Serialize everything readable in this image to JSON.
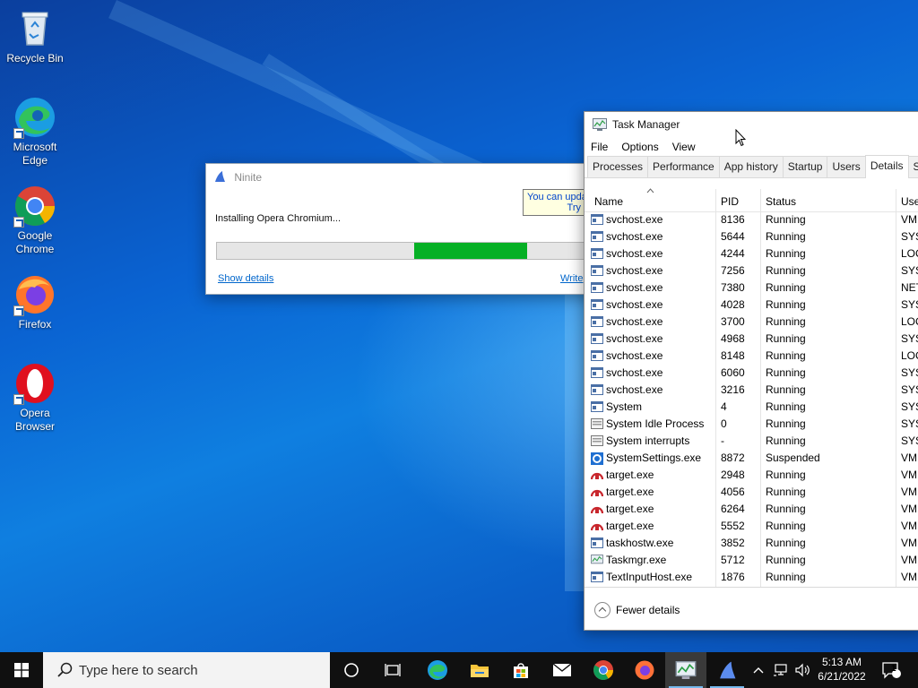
{
  "desktop_icons": [
    {
      "label": "Recycle Bin",
      "icon": "recycle-bin-icon"
    },
    {
      "label": "Microsoft Edge",
      "icon": "edge-icon"
    },
    {
      "label": "Google Chrome",
      "icon": "chrome-icon"
    },
    {
      "label": "Firefox",
      "icon": "firefox-icon"
    },
    {
      "label": "Opera Browser",
      "icon": "opera-icon"
    }
  ],
  "ninite": {
    "title": "Ninite",
    "status": "Installing Opera Chromium...",
    "progress": 0.3,
    "show_details": "Show details",
    "write_link": "Write",
    "tooltip_line1": "You can upda",
    "tooltip_line2": "Try"
  },
  "taskmgr": {
    "title": "Task Manager",
    "menu": [
      "File",
      "Options",
      "View"
    ],
    "tabs": [
      "Processes",
      "Performance",
      "App history",
      "Startup",
      "Users",
      "Details",
      "Se"
    ],
    "active_tab": "Details",
    "columns": {
      "name": "Name",
      "pid": "PID",
      "status": "Status",
      "user": "Use"
    },
    "rows": [
      {
        "name": "svchost.exe",
        "pid": "8136",
        "status": "Running",
        "user": "VM",
        "icon": "service-icon"
      },
      {
        "name": "svchost.exe",
        "pid": "5644",
        "status": "Running",
        "user": "SYS",
        "icon": "service-icon"
      },
      {
        "name": "svchost.exe",
        "pid": "4244",
        "status": "Running",
        "user": "LOC",
        "icon": "service-icon"
      },
      {
        "name": "svchost.exe",
        "pid": "7256",
        "status": "Running",
        "user": "SYS",
        "icon": "service-icon"
      },
      {
        "name": "svchost.exe",
        "pid": "7380",
        "status": "Running",
        "user": "NET",
        "icon": "service-icon"
      },
      {
        "name": "svchost.exe",
        "pid": "4028",
        "status": "Running",
        "user": "SYS",
        "icon": "service-icon"
      },
      {
        "name": "svchost.exe",
        "pid": "3700",
        "status": "Running",
        "user": "LOC",
        "icon": "service-icon"
      },
      {
        "name": "svchost.exe",
        "pid": "4968",
        "status": "Running",
        "user": "SYS",
        "icon": "service-icon"
      },
      {
        "name": "svchost.exe",
        "pid": "8148",
        "status": "Running",
        "user": "LOC",
        "icon": "service-icon"
      },
      {
        "name": "svchost.exe",
        "pid": "6060",
        "status": "Running",
        "user": "SYS",
        "icon": "service-icon"
      },
      {
        "name": "svchost.exe",
        "pid": "3216",
        "status": "Running",
        "user": "SYS",
        "icon": "service-icon"
      },
      {
        "name": "System",
        "pid": "4",
        "status": "Running",
        "user": "SYS",
        "icon": "service-icon"
      },
      {
        "name": "System Idle Process",
        "pid": "0",
        "status": "Running",
        "user": "SYS",
        "icon": "process-icon"
      },
      {
        "name": "System interrupts",
        "pid": "-",
        "status": "Running",
        "user": "SYS",
        "icon": "process-icon"
      },
      {
        "name": "SystemSettings.exe",
        "pid": "8872",
        "status": "Suspended",
        "user": "VM",
        "icon": "settings-gear-icon"
      },
      {
        "name": "target.exe",
        "pid": "2948",
        "status": "Running",
        "user": "VM",
        "icon": "target-icon"
      },
      {
        "name": "target.exe",
        "pid": "4056",
        "status": "Running",
        "user": "VM",
        "icon": "target-icon"
      },
      {
        "name": "target.exe",
        "pid": "6264",
        "status": "Running",
        "user": "VM",
        "icon": "target-icon"
      },
      {
        "name": "target.exe",
        "pid": "5552",
        "status": "Running",
        "user": "VM",
        "icon": "target-icon"
      },
      {
        "name": "taskhostw.exe",
        "pid": "3852",
        "status": "Running",
        "user": "VM",
        "icon": "service-icon"
      },
      {
        "name": "Taskmgr.exe",
        "pid": "5712",
        "status": "Running",
        "user": "VM",
        "icon": "taskmgr-icon"
      },
      {
        "name": "TextInputHost.exe",
        "pid": "1876",
        "status": "Running",
        "user": "VM",
        "icon": "service-icon"
      }
    ],
    "fewer_details": "Fewer details"
  },
  "taskbar": {
    "search_placeholder": "Type here to search",
    "time": "5:13 AM",
    "date": "6/21/2022",
    "notification_count": "1"
  },
  "colors": {
    "progress_green": "#06b025",
    "taskbar": "#101010",
    "link_blue": "#0066cc"
  }
}
